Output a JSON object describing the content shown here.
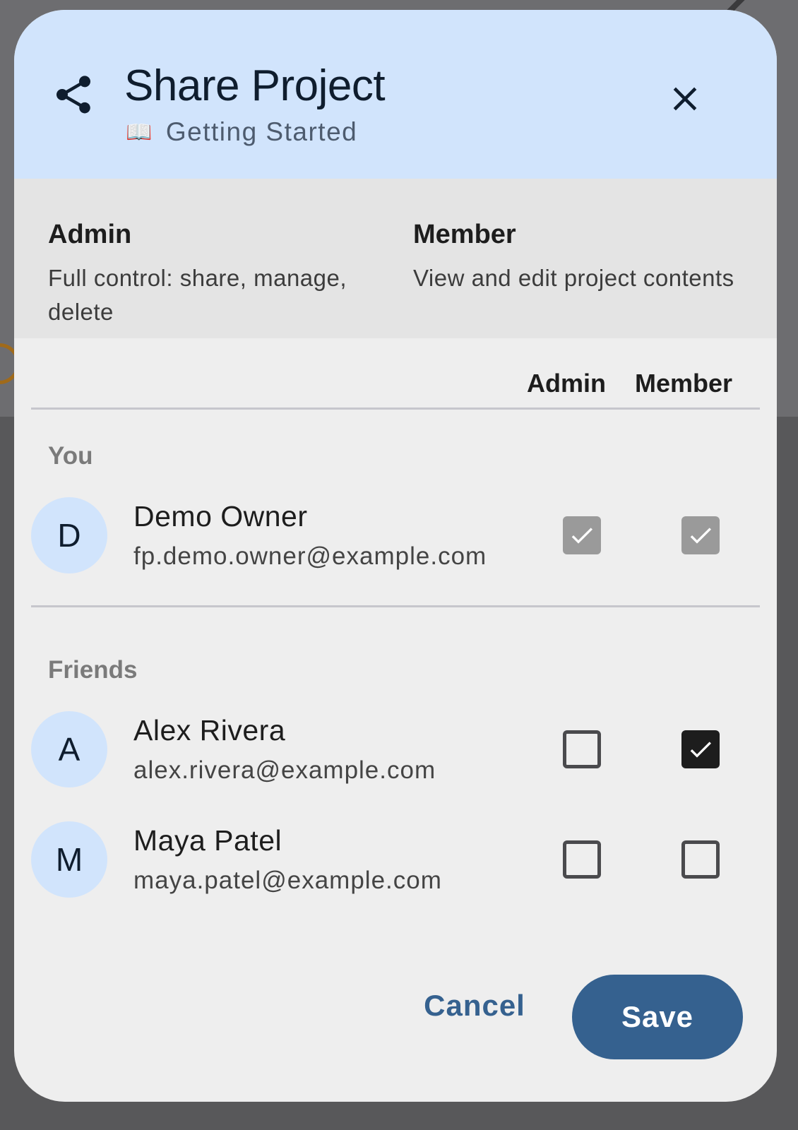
{
  "dialog": {
    "title": "Share Project",
    "subtitle": "Getting Started",
    "subtitle_icon": "📖"
  },
  "legend": {
    "admin": {
      "title": "Admin",
      "description": "Full control: share, manage, delete"
    },
    "member": {
      "title": "Member",
      "description": "View and edit project contents"
    }
  },
  "columns": {
    "admin": "Admin",
    "member": "Member"
  },
  "sections": {
    "you": {
      "label": "You",
      "rows": [
        {
          "initial": "D",
          "name": "Demo Owner",
          "email": "fp.demo.owner@example.com",
          "admin": true,
          "member": true,
          "disabled": true
        }
      ]
    },
    "friends": {
      "label": "Friends",
      "rows": [
        {
          "initial": "A",
          "name": "Alex Rivera",
          "email": "alex.rivera@example.com",
          "admin": false,
          "member": true,
          "disabled": false
        },
        {
          "initial": "M",
          "name": "Maya Patel",
          "email": "maya.patel@example.com",
          "admin": false,
          "member": false,
          "disabled": false
        }
      ]
    }
  },
  "actions": {
    "cancel": "Cancel",
    "save": "Save"
  },
  "icons": {
    "share": "share-icon",
    "close": "close-icon",
    "book": "book-icon",
    "check": "check-icon"
  },
  "colors": {
    "header_bg": "#d1e4fc",
    "primary": "#35618f",
    "dialog_bg": "#eeeeee",
    "legend_bg": "#e4e4e4"
  }
}
